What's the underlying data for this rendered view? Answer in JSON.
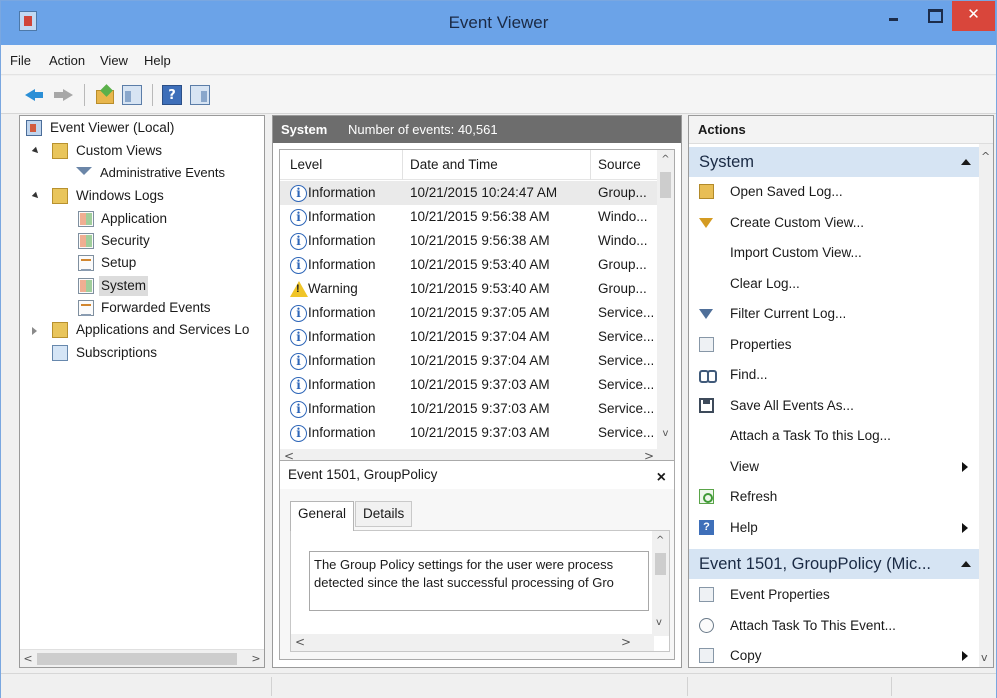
{
  "window": {
    "title": "Event Viewer"
  },
  "menu": [
    "File",
    "Action",
    "View",
    "Help"
  ],
  "toolbar": {
    "help_label": "?"
  },
  "tree": {
    "root": "Event Viewer (Local)",
    "custom_views": "Custom Views",
    "administrative_events": "Administrative Events",
    "windows_logs": "Windows Logs",
    "application": "Application",
    "security": "Security",
    "setup": "Setup",
    "system": "System",
    "forwarded_events": "Forwarded Events",
    "apps_services": "Applications and Services Lo",
    "subscriptions": "Subscriptions"
  },
  "center": {
    "log_name": "System",
    "count_text": "Number of events: 40,561",
    "columns": [
      "Level",
      "Date and Time",
      "Source"
    ],
    "rows": [
      {
        "level": "Information",
        "type": "info",
        "datetime": "10/21/2015 10:24:47 AM",
        "source": "Group..."
      },
      {
        "level": "Information",
        "type": "info",
        "datetime": "10/21/2015 9:56:38 AM",
        "source": "Windo..."
      },
      {
        "level": "Information",
        "type": "info",
        "datetime": "10/21/2015 9:56:38 AM",
        "source": "Windo..."
      },
      {
        "level": "Information",
        "type": "info",
        "datetime": "10/21/2015 9:53:40 AM",
        "source": "Group..."
      },
      {
        "level": "Warning",
        "type": "warn",
        "datetime": "10/21/2015 9:53:40 AM",
        "source": "Group..."
      },
      {
        "level": "Information",
        "type": "info",
        "datetime": "10/21/2015 9:37:05 AM",
        "source": "Service..."
      },
      {
        "level": "Information",
        "type": "info",
        "datetime": "10/21/2015 9:37:04 AM",
        "source": "Service..."
      },
      {
        "level": "Information",
        "type": "info",
        "datetime": "10/21/2015 9:37:04 AM",
        "source": "Service..."
      },
      {
        "level": "Information",
        "type": "info",
        "datetime": "10/21/2015 9:37:03 AM",
        "source": "Service..."
      },
      {
        "level": "Information",
        "type": "info",
        "datetime": "10/21/2015 9:37:03 AM",
        "source": "Service..."
      },
      {
        "level": "Information",
        "type": "info",
        "datetime": "10/21/2015 9:37:03 AM",
        "source": "Service..."
      }
    ],
    "detail": {
      "title": "Event 1501, GroupPolicy",
      "tabs": [
        "General",
        "Details"
      ],
      "line1": "The Group Policy settings for the user were process",
      "line2": "detected since the last successful processing of Gro"
    }
  },
  "actions": {
    "header": "Actions",
    "section1": "System",
    "items1": [
      {
        "label": "Open Saved Log...",
        "icon": "open-log-icon",
        "submenu": false
      },
      {
        "label": "Create Custom View...",
        "icon": "create-view-icon",
        "submenu": false
      },
      {
        "label": "Import Custom View...",
        "icon": "",
        "submenu": false
      },
      {
        "label": "Clear Log...",
        "icon": "",
        "submenu": false
      },
      {
        "label": "Filter Current Log...",
        "icon": "filter-icon",
        "submenu": false
      },
      {
        "label": "Properties",
        "icon": "properties-icon",
        "submenu": false
      },
      {
        "label": "Find...",
        "icon": "find-icon",
        "submenu": false
      },
      {
        "label": "Save All Events As...",
        "icon": "save-icon",
        "submenu": false
      },
      {
        "label": "Attach a Task To this Log...",
        "icon": "",
        "submenu": false
      },
      {
        "label": "View",
        "icon": "",
        "submenu": true
      },
      {
        "label": "Refresh",
        "icon": "refresh-icon",
        "submenu": false
      },
      {
        "label": "Help",
        "icon": "help-icon",
        "submenu": true
      }
    ],
    "section2": "Event 1501, GroupPolicy (Mic...",
    "items2": [
      {
        "label": "Event Properties",
        "icon": "event-properties-icon",
        "submenu": false
      },
      {
        "label": "Attach Task To This Event...",
        "icon": "attach-task-icon",
        "submenu": false
      },
      {
        "label": "Copy",
        "icon": "copy-icon",
        "submenu": true
      }
    ]
  },
  "colors": {
    "titlebar": "#6ba3e8",
    "close": "#d9463b",
    "section": "#d6e4f3",
    "center_header": "#6d6d6d"
  }
}
